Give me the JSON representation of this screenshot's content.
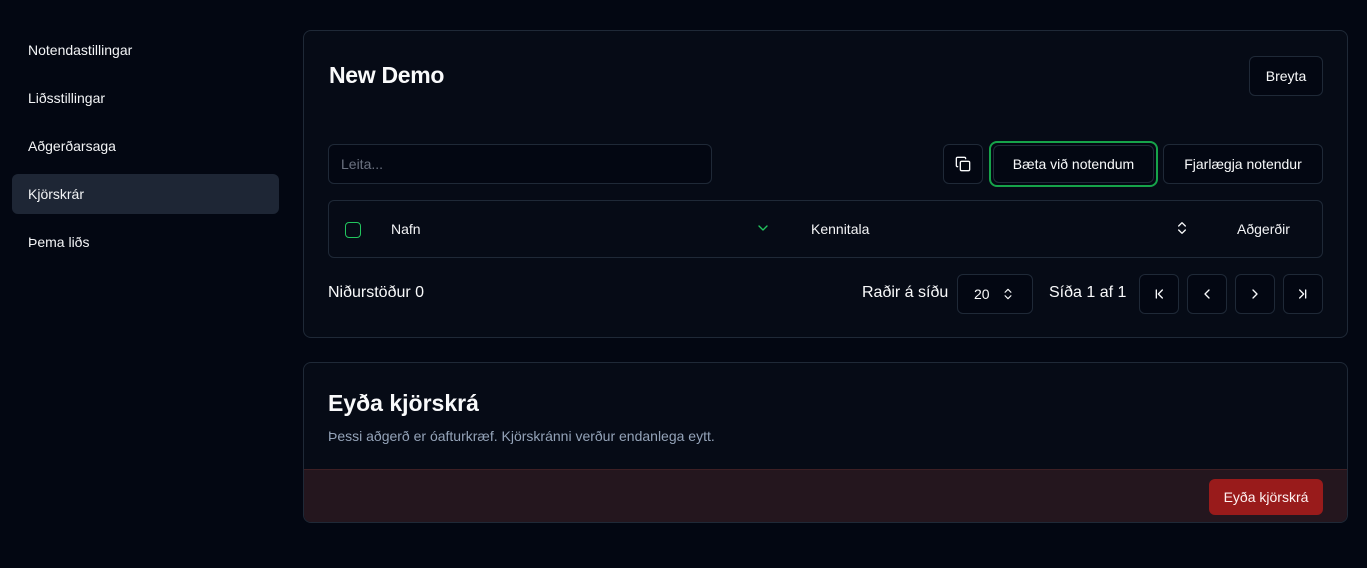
{
  "sidebar": {
    "items": [
      {
        "label": "Notendastillingar"
      },
      {
        "label": "Liðsstillingar"
      },
      {
        "label": "Aðgerðarsaga"
      },
      {
        "label": "Kjörskrár",
        "active": true
      },
      {
        "label": "Þema liðs"
      }
    ]
  },
  "main": {
    "title": "New Demo",
    "edit_label": "Breyta",
    "search_placeholder": "Leita...",
    "copy_icon": "copy-icon",
    "add_users_label": "Bæta við notendum",
    "remove_users_label": "Fjarlægja notendur",
    "table": {
      "columns": [
        "Nafn",
        "Kennitala",
        "Aðgerðir"
      ],
      "rows": []
    },
    "results_label": "Niðurstöður 0",
    "rows_per_page_label": "Raðir á síðu",
    "rows_per_page_value": "20",
    "page_label": "Síða 1 af 1"
  },
  "danger": {
    "title": "Eyða kjörskrá",
    "description": "Þessi aðgerð er óafturkræf. Kjörskránni verður endanlega eytt.",
    "delete_label": "Eyða kjörskrá"
  },
  "colors": {
    "accent": "#16a34a",
    "danger": "#991b1b",
    "background": "#030712"
  }
}
